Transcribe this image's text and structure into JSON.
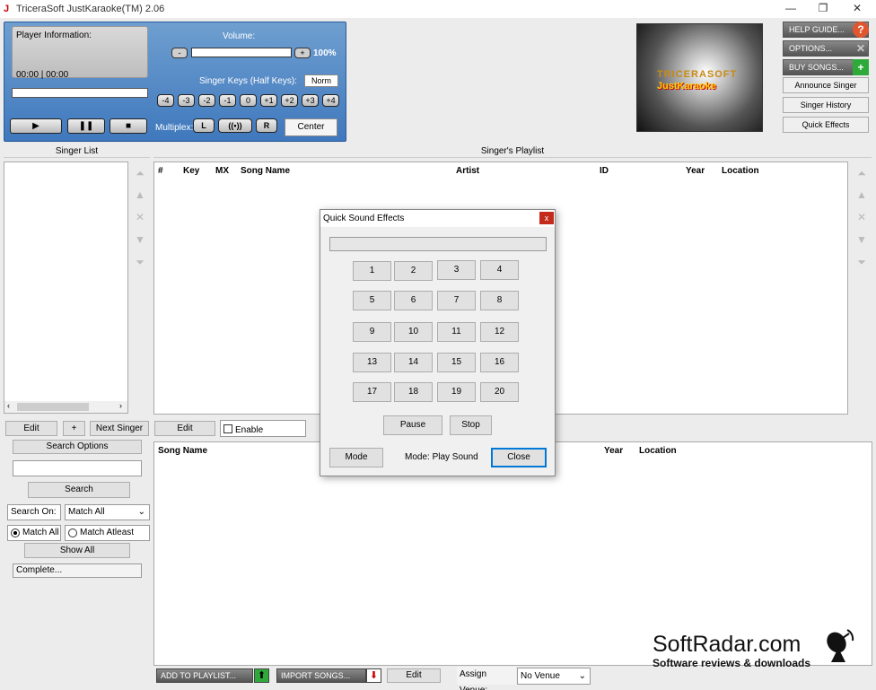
{
  "window": {
    "title": "TriceraSoft JustKaraoke(TM) 2.06",
    "controls": [
      "—",
      "❐",
      "✕"
    ]
  },
  "player": {
    "info_label": "Player Information:",
    "time": "00:00 | 00:00",
    "volume_label": "Volume:",
    "volume_minus": "-",
    "volume_plus": "+",
    "volume_percent": "100%",
    "volume_level": 1.0,
    "progress": 0,
    "keys_label": "Singer Keys (Half Keys):",
    "key_mode": "Norm",
    "keys": [
      "-4",
      "-3",
      "-2",
      "-1",
      "0",
      "+1",
      "+2",
      "+3",
      "+4"
    ],
    "play": "▶",
    "pause": "❚❚",
    "stop": "■",
    "multiplex_label": "Multiplex:",
    "multiplex_left": "L",
    "multiplex_both": "((•))",
    "multiplex_right": "R",
    "center": "Center"
  },
  "logo": {
    "line1": "TRICERASOFT",
    "line2": "JustKaraoke"
  },
  "right_buttons": {
    "help": "HELP GUIDE...",
    "options": "OPTIONS...",
    "buy": "BUY SONGS...",
    "announce": "Announce Singer",
    "history": "Singer History",
    "quick_effects": "Quick Effects"
  },
  "singer_list": {
    "header": "Singer List",
    "edit": "Edit",
    "add": "+",
    "next": "Next Singer"
  },
  "playlist": {
    "header": "Singer's Playlist",
    "columns": [
      "#",
      "Key",
      "MX",
      "Song Name",
      "Artist",
      "ID",
      "Year",
      "Location"
    ],
    "edit": "Edit",
    "enable": "Enable"
  },
  "search": {
    "options": "Search Options",
    "query": "",
    "search": "Search",
    "search_on_label": "Search On:",
    "search_on_value": "Match All",
    "match_all": "Match All",
    "match_atleast": "Match Atleast One",
    "show_all": "Show All",
    "status": "Complete..."
  },
  "results": {
    "columns": [
      "Song Name",
      "Year",
      "Location"
    ]
  },
  "bottom_bar": {
    "add_to_playlist": "ADD TO PLAYLIST...",
    "import_songs": "IMPORT SONGS...",
    "edit": "Edit",
    "assign_venue_label": "Assign Venue:",
    "venue": "No Venue"
  },
  "dialog": {
    "title": "Quick Sound Effects",
    "close_x": "x",
    "effects": [
      "1",
      "2",
      "3",
      "4",
      "5",
      "6",
      "7",
      "8",
      "9",
      "10",
      "11",
      "12",
      "13",
      "14",
      "15",
      "16",
      "17",
      "18",
      "19",
      "20"
    ],
    "pause": "Pause",
    "stop": "Stop",
    "mode": "Mode",
    "mode_status": "Mode: Play Sound",
    "close": "Close"
  },
  "watermark": {
    "name": "SoftRadar.com",
    "tagline": "Software reviews & downloads"
  }
}
